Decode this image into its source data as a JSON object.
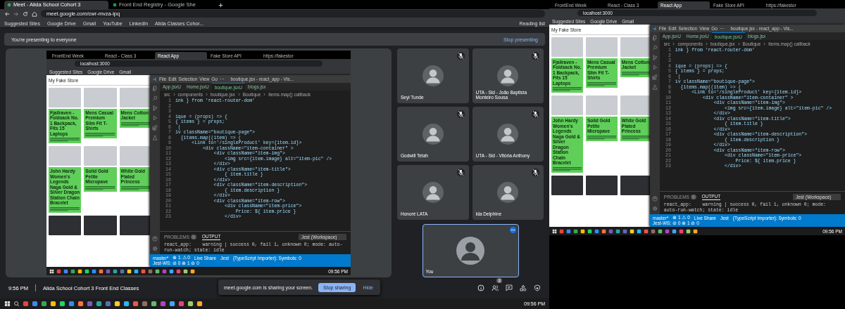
{
  "browser": {
    "tabs": [
      {
        "title": "Meet - Alida School Cohort 3",
        "selected": true
      },
      {
        "title": "Front End Registry - Google She",
        "selected": false
      }
    ],
    "address": "meet.google.com/cwr-mvza-ipq",
    "bookmarks": [
      "Suggested Sites",
      "Google Drive",
      "Gmail",
      "YouTube",
      "LinkedIn",
      "Alida Classes Cohor..."
    ],
    "reading_list": "Reading list"
  },
  "meet": {
    "banner": {
      "text": "You're presenting to everyone",
      "action": "Stop presenting"
    },
    "presentation": {
      "screen": {
        "browser": {
          "tabs": [
            {
              "title": "FrontEnd Week",
              "selected": false
            },
            {
              "title": "React - Class 3",
              "selected": false
            },
            {
              "title": "React App",
              "selected": true
            },
            {
              "title": "Fake Store API",
              "selected": false
            },
            {
              "title": "https://fakestor",
              "selected": false
            }
          ],
          "address": "localhost:3000",
          "bookmarks": [
            "Suggested Sites",
            "Google Drive",
            "Gmail"
          ]
        },
        "store": {
          "title": "My Fake Store",
          "products": [
            {
              "title": "Fjallraven - Foldsack No. 1 Backpack, Fits 15 Laptops",
              "dark": false
            },
            {
              "title": "Mens Casual Premium Slim Fit T-Shirts",
              "dark": false
            },
            {
              "title": "Mens Cotton Jacket",
              "dark": false
            },
            {
              "title": "John Hardy Women's Legends Naga Gold & Silver Dragon Station Chain Bracelet",
              "dark": false
            },
            {
              "title": "Solid Gold Petite Micropave",
              "dark": false
            },
            {
              "title": "White Gold Plated Princess",
              "dark": false
            },
            {
              "dark": true
            },
            {
              "dark": true
            },
            {
              "dark": true
            }
          ]
        },
        "vscode": {
          "menu": [
            "File",
            "Edit",
            "Selection",
            "View",
            "Go",
            "···"
          ],
          "title": "boutique.jsx - react_app - Vis...",
          "tabs": [
            {
              "label": "App.jsx",
              "status": "U",
              "selected": false
            },
            {
              "label": "Home.jsx",
              "status": "U",
              "selected": false
            },
            {
              "label": "boutique.jsx",
              "status": "U",
              "selected": true
            },
            {
              "label": "blogs.jsx",
              "selected": false
            }
          ],
          "breadcrumb": [
            "src",
            "components",
            "boutique.jsx",
            "Boutique",
            "items.map() callback"
          ],
          "code": [
            {
              "number": "1",
              "text": "ink } from 'react-router-dom'"
            },
            {
              "number": "2"
            },
            {
              "number": "3"
            },
            {
              "number": "4",
              "text": "ique = (props) => {"
            },
            {
              "number": "5",
              "text": "{ items } = props;"
            },
            {
              "number": "6",
              "text": " ("
            },
            {
              "number": "7",
              "text": "iv className=\"boutique-page\">"
            },
            {
              "number": "8",
              "text": "  {items.map((item) => ("
            },
            {
              "number": "9",
              "text": "      <Link to='/singleProduct' key={item.id}>"
            },
            {
              "number": "10",
              "text": "          <div className=\"item-container\" >"
            },
            {
              "number": "11",
              "text": "              <div className=\"item-img\">"
            },
            {
              "number": "12",
              "text": "                  <img src={item.image} alt=\"item-pic\" />"
            },
            {
              "number": "13",
              "text": "              </div>"
            },
            {
              "number": "14",
              "text": "              <div className=\"item-title\">"
            },
            {
              "number": "15",
              "text": "                  { item.title }"
            },
            {
              "number": "16",
              "text": "              </div>"
            },
            {
              "number": "17",
              "text": "              <div className=\"item-description\">"
            },
            {
              "number": "18",
              "text": "                  { item.description }"
            },
            {
              "number": "19",
              "text": "              </div>"
            },
            {
              "number": "20",
              "text": "              <div className=\"item-row\">"
            },
            {
              "number": "21",
              "text": "                  <div className=\"item-price\">"
            },
            {
              "number": "22",
              "text": "                      Price: ${ item.price }"
            },
            {
              "number": "23",
              "text": "                  </div>"
            }
          ],
          "panel": {
            "tabs": [
              {
                "label": "PROBLEMS",
                "badge": "9",
                "selected": false
              },
              {
                "label": "OUTPUT",
                "selected": true
              }
            ],
            "dropdown": "Jest (Workspace)",
            "output": "react_app:    warning | success 0, fail 1, unknown 0; mode: auto-run-watch; state: idle"
          },
          "status": [
            "master*",
            "⊗ 1 ⚠ 0",
            "Live Share",
            "Jest",
            "{TypeScript Importer}: Symbols: 0",
            "Jest-WS: ⊘ 0 ⊗ 1 ⊘ 0"
          ]
        },
        "taskbar": {
          "time": "09:56 PM"
        }
      }
    },
    "participants": [
      {
        "name": "Seyi Tunde",
        "muted": true,
        "selected": false
      },
      {
        "name": "UTA - Sid - João Baptista Monteiro Sousa",
        "muted": true,
        "selected": false
      },
      {
        "name": "Godwill Tetah",
        "muted": true,
        "selected": false
      },
      {
        "name": "UTA - Sid - Vitória Anthony",
        "muted": true,
        "selected": false
      },
      {
        "name": "Honoré LATA",
        "muted": true,
        "selected": false
      },
      {
        "name": "Ida Delphine",
        "muted": true,
        "selected": false
      },
      {
        "name": "You",
        "muted": false,
        "selected": true
      }
    ],
    "bottom_bar": {
      "time": "9:56 PM",
      "meeting": "Alida School Cohort 3 Front End Classes",
      "people_count": "8"
    },
    "share_notice": {
      "text": "meet.google.com is sharing your screen.",
      "stop": "Stop sharing",
      "hide": "Hide"
    }
  },
  "taskbar": {
    "time": "09:56 PM"
  },
  "second_monitor": {
    "screen": {
      "browser": {
        "tabs": [
          {
            "title": "FrontEnd Week",
            "selected": false
          },
          {
            "title": "React - Class 3",
            "selected": false
          },
          {
            "title": "React App",
            "selected": true
          },
          {
            "title": "Fake Store API",
            "selected": false
          },
          {
            "title": "https://fakestor",
            "selected": false
          }
        ],
        "address": "localhost:3000",
        "bookmarks": [
          "Suggested Sites",
          "Google Drive",
          "Gmail"
        ]
      },
      "store": {
        "title": "My Fake Store",
        "products": [
          {
            "title": "Fjallraven - Foldsack No. 1 Backpack, Fits 15 Laptops",
            "dark": false
          },
          {
            "title": "Mens Casual Premium Slim Fit T-Shirts",
            "dark": false
          },
          {
            "title": "Mens Cotton Jacket",
            "dark": false
          },
          {
            "title": "John Hardy Women's Legends Naga Gold & Silver Dragon Station Chain Bracelet",
            "dark": false
          },
          {
            "title": "Solid Gold Petite Micropave",
            "dark": false
          },
          {
            "title": "White Gold Plated Princess",
            "dark": false
          },
          {
            "dark": true
          },
          {
            "dark": true
          },
          {
            "dark": true
          }
        ]
      },
      "vscode": {
        "menu": [
          "File",
          "Edit",
          "Selection",
          "View",
          "Go",
          "···"
        ],
        "title": "boutique.jsx - react_app - Vis...",
        "tabs": [
          {
            "label": "App.jsx",
            "status": "U",
            "selected": false
          },
          {
            "label": "Home.jsx",
            "status": "U",
            "selected": false
          },
          {
            "label": "boutique.jsx",
            "status": "U",
            "selected": true
          },
          {
            "label": "blogs.jsx",
            "selected": false
          }
        ],
        "breadcrumb": [
          "src",
          "components",
          "boutique.jsx",
          "Boutique",
          "items.map() callback"
        ],
        "code": [
          {
            "number": "1",
            "text": "ink } from 'react-router-dom'"
          },
          {
            "number": "2"
          },
          {
            "number": "3"
          },
          {
            "number": "4",
            "text": "ique = (props) => {"
          },
          {
            "number": "5",
            "text": "{ items } = props;"
          },
          {
            "number": "6",
            "text": " ("
          },
          {
            "number": "7",
            "text": "iv className=\"boutique-page\">"
          },
          {
            "number": "8",
            "text": "  {items.map((item) => ("
          },
          {
            "number": "9",
            "text": "      <Link to='/singleProduct' key={item.id}>"
          },
          {
            "number": "10",
            "text": "          <div className=\"item-container\" >"
          },
          {
            "number": "11",
            "text": "              <div className=\"item-img\">"
          },
          {
            "number": "12",
            "text": "                  <img src={item.image} alt=\"item-pic\" />"
          },
          {
            "number": "13",
            "text": "              </div>"
          },
          {
            "number": "14",
            "text": "              <div className=\"item-title\">"
          },
          {
            "number": "15",
            "text": "                  { item.title }"
          },
          {
            "number": "16",
            "text": "              </div>"
          },
          {
            "number": "17",
            "text": "              <div className=\"item-description\">"
          },
          {
            "number": "18",
            "text": "                  { item.description }"
          },
          {
            "number": "19",
            "text": "              </div>"
          },
          {
            "number": "20",
            "text": "              <div className=\"item-row\">"
          },
          {
            "number": "21",
            "text": "                  <div className=\"item-price\">"
          },
          {
            "number": "22",
            "text": "                      Price: ${ item.price }"
          },
          {
            "number": "23",
            "text": "                  </div>"
          }
        ],
        "panel": {
          "tabs": [
            {
              "label": "PROBLEMS",
              "badge": "9",
              "selected": false
            },
            {
              "label": "OUTPUT",
              "selected": true
            }
          ],
          "dropdown": "Jest (Workspace)",
          "output": "react_app:    warning | success 0, fail 1, unknown 0; mode: auto-run-watch; state: idle"
        },
        "status": [
          "master*",
          "⊗ 1 ⚠ 0",
          "Live Share",
          "Jest",
          "{TypeScript Importer}: Symbols: 0",
          "Jest-WS: ⊘ 0 ⊗ 1 ⊘ 0"
        ]
      },
      "taskbar": {
        "time": "09:56 PM"
      }
    }
  }
}
